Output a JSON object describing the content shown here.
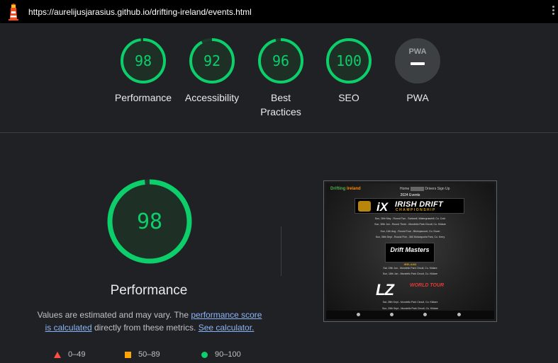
{
  "topbar": {
    "url": "https://aurelijusjarasius.github.io/drifting-ireland/events.html",
    "logo_icon": "lighthouse-icon",
    "menu_icon": "kebab-menu-icon"
  },
  "scores": [
    {
      "label": "Performance",
      "score": "98",
      "fraction": 0.98
    },
    {
      "label": "Accessibility",
      "score": "92",
      "fraction": 0.92
    },
    {
      "label": "Best",
      "label2": "Practices",
      "score": "96",
      "fraction": 0.96
    },
    {
      "label": "SEO",
      "score": "100",
      "fraction": 1.0
    },
    {
      "label": "PWA",
      "badge": "PWA"
    }
  ],
  "colors": {
    "pass": "#0cce6b",
    "average": "#ffa400",
    "fail": "#ff4e42",
    "link": "#8ab4f8",
    "background": "#202124"
  },
  "performance": {
    "score": "98",
    "fraction": 0.98,
    "title": "Performance",
    "note_prefix": "Values are estimated and may vary. The",
    "note_link1a": "performance score",
    "note_link1b": "is calculated",
    "note_middle": "directly from these metrics.",
    "note_link2": "See calculator."
  },
  "legend": [
    {
      "range": "0–49",
      "icon": "triangle-icon"
    },
    {
      "range": "50–89",
      "icon": "square-icon"
    },
    {
      "range": "90–100",
      "icon": "circle-icon"
    }
  ],
  "screenshot": {
    "brand_a": "Drifting",
    "brand_b": "Ireland",
    "nav": [
      "Home",
      "Events",
      "Drivers",
      "Sign Up"
    ],
    "heading": "2024 Events",
    "idc_logo_a": "iX",
    "idc_logo_b": "IRISH DRIFT",
    "idc_logo_c": "CHAMPIONSHIP",
    "idc_events": [
      "Sun, 26th May - Round Two - Sorkwell, Watergrasshill, Co. Cork",
      "Sun, 30th Jun - Round Three - Mondello Park Circuit, Co. Kildare",
      "Sun, 11th Aug - Round Four - Bishopscourt, Co. Down",
      "Sun, 08th Sept - Round Five - 360 Motorsports Park, Co. Kerry"
    ],
    "dm_logo": "Drift Masters",
    "dm_country": "IRELAND",
    "dm_events": [
      "Sat, 15th Jun - Mondello Park Circuit, Co. Kildare",
      "Sun, 16th Jun - Mondello Park Circuit, Co. Kildare"
    ],
    "lz_logo": "LZ",
    "lz_sub": "WORLD TOUR",
    "lz_events": [
      "Sat, 28th Sept - Mondello Park Circuit, Co. Kildare",
      "Sun, 29th Sept - Mondello Park Circuit, Co. Kildare"
    ],
    "footer_icons": [
      "facebook-icon",
      "instagram-icon",
      "tiktok-icon",
      "youtube-icon"
    ]
  }
}
